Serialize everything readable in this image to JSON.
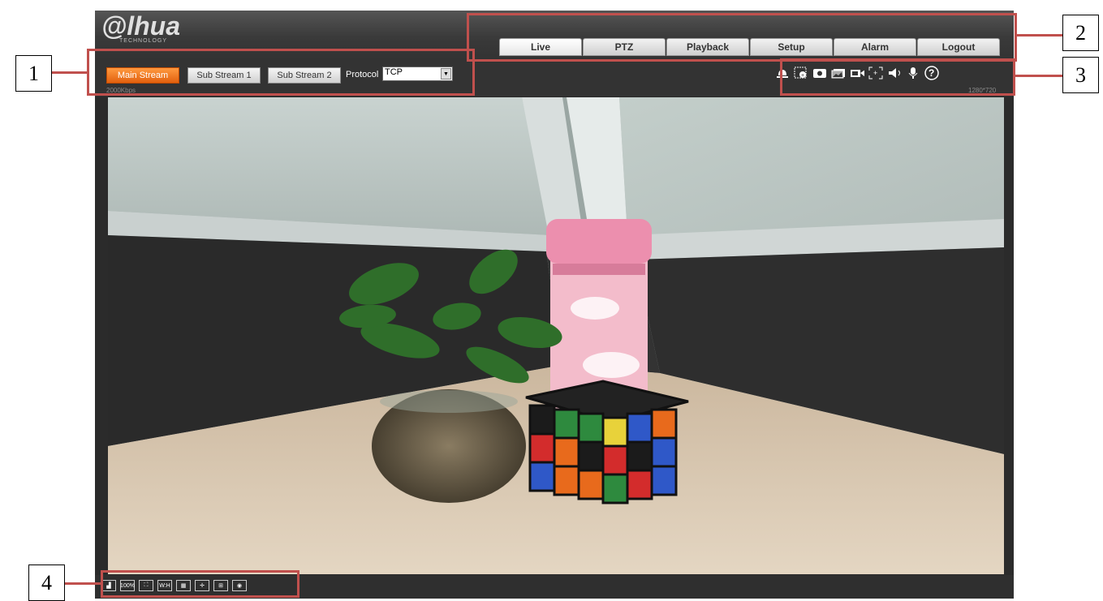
{
  "logo": {
    "text": "alhua",
    "sub": "TECHNOLOGY"
  },
  "nav_tabs": [
    "Live",
    "PTZ",
    "Playback",
    "Setup",
    "Alarm",
    "Logout"
  ],
  "streams": {
    "main": "Main Stream",
    "sub1": "Sub Stream 1",
    "sub2": "Sub Stream 2"
  },
  "protocol": {
    "label": "Protocol",
    "value": "TCP"
  },
  "stream_info": {
    "bitrate": "2000Kbps",
    "resolution": "1280*720"
  },
  "top_icons": [
    "alarm-output-icon",
    "zoom-in-icon",
    "snapshot-icon",
    "triple-snapshot-icon",
    "record-icon",
    "region-icon",
    "audio-output-icon",
    "microphone-icon",
    "help-icon"
  ],
  "bottom_icons": [
    "image-adjust-icon",
    "original-size-icon",
    "fullscreen-icon",
    "aspect-ratio-icon",
    "fluency-icon",
    "rule-icon",
    "zoom-focus-icon",
    "fisheye-icon"
  ],
  "bottom_labels": {
    "original_size": "100%",
    "aspect": "W:H"
  },
  "callouts": [
    "1",
    "2",
    "3",
    "4"
  ],
  "colors": {
    "accent": "#e8661a",
    "callout": "#c0504d"
  }
}
